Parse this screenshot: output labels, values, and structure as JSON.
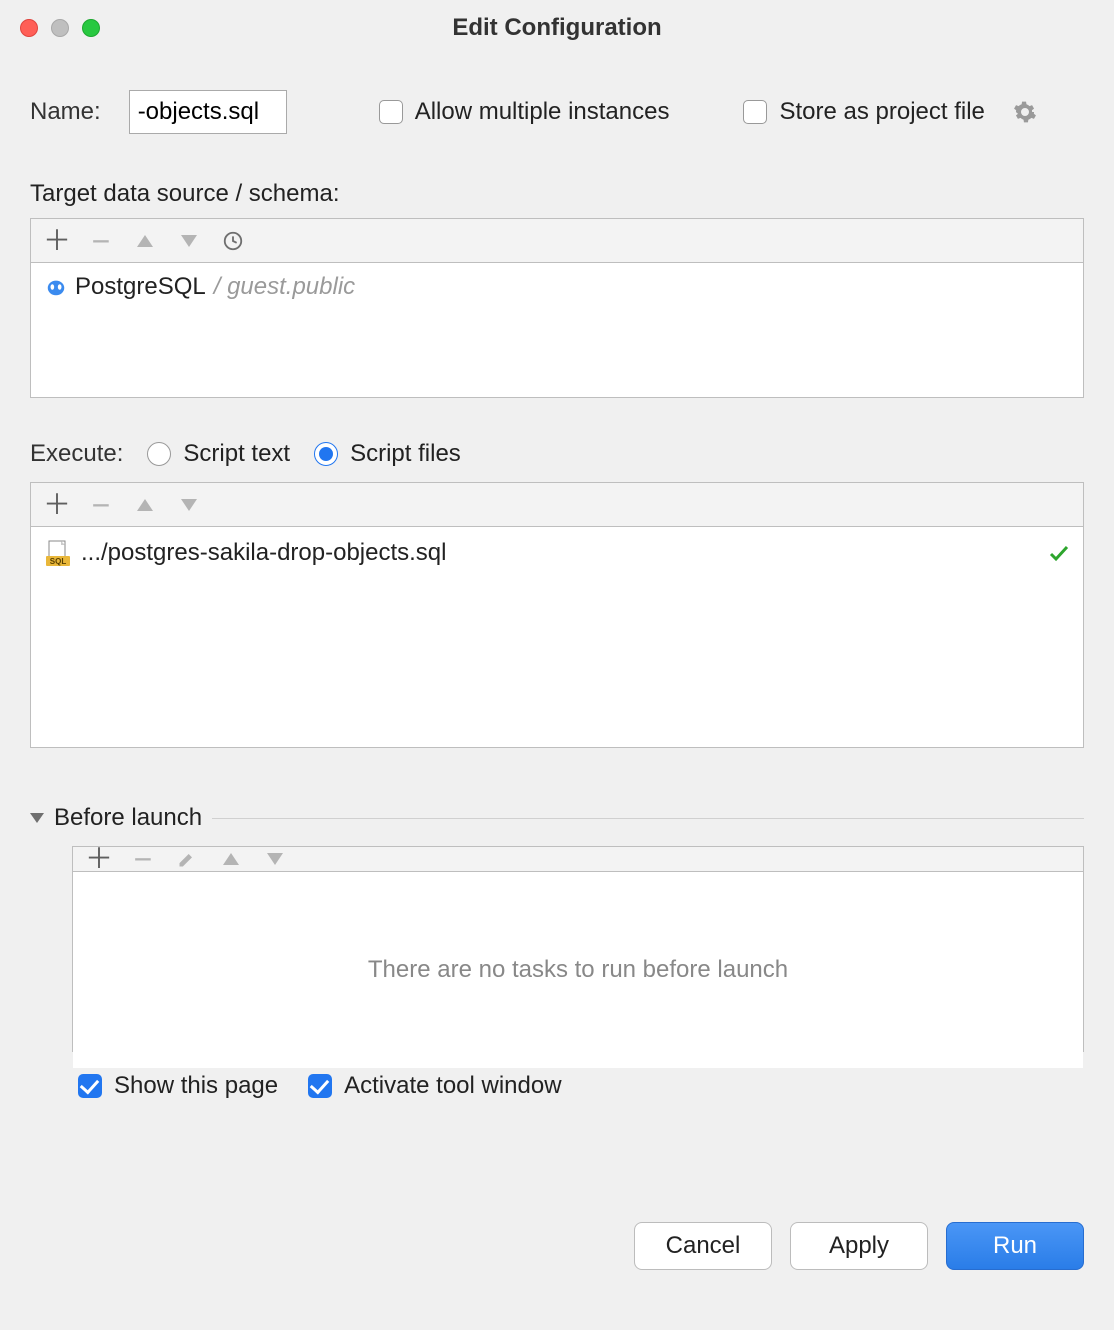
{
  "title": "Edit Configuration",
  "name_label": "Name:",
  "name_value": "-objects.sql",
  "allow_multiple_label": "Allow multiple instances",
  "allow_multiple_checked": false,
  "store_project_label": "Store as project file",
  "store_project_checked": false,
  "target_label": "Target data source / schema:",
  "datasource": {
    "name": "PostgreSQL",
    "schema": "/ guest.public"
  },
  "execute_label": "Execute:",
  "execute_options": {
    "script_text": "Script text",
    "script_files": "Script files"
  },
  "execute_selected": "script_files",
  "script_file_path": ".../postgres-sakila-drop-objects.sql",
  "before_launch_label": "Before launch",
  "before_launch_empty": "There are no tasks to run before launch",
  "show_this_page_label": "Show this page",
  "show_this_page_checked": true,
  "activate_tool_label": "Activate tool window",
  "activate_tool_checked": true,
  "buttons": {
    "cancel": "Cancel",
    "apply": "Apply",
    "run": "Run"
  }
}
